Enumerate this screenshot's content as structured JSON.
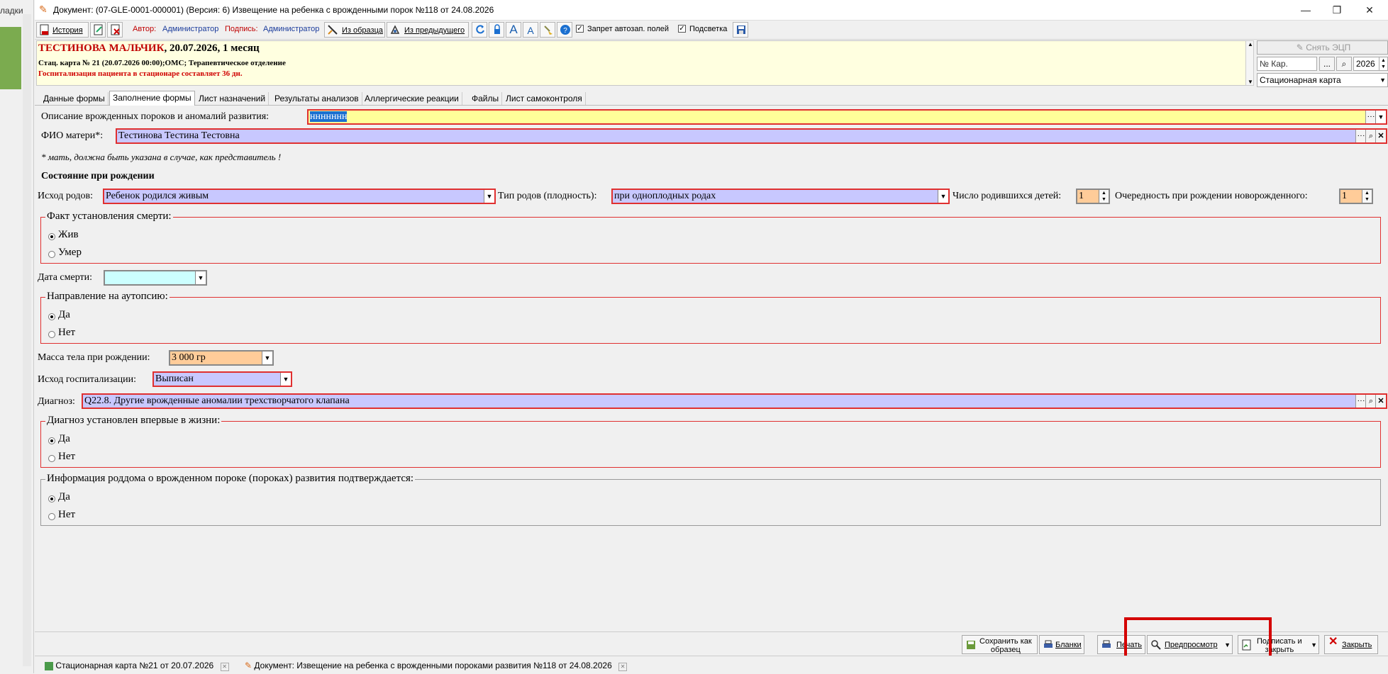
{
  "left_strip": {
    "label": "ладки"
  },
  "window": {
    "title": "Документ: (07-GLE-0001-000001) (Версия: 6) Извещение на ребенка с врожденными порок №118 от 24.08.2026",
    "minimize": "—",
    "restore": "❐",
    "close": "✕"
  },
  "toolbar": {
    "history": "История",
    "author_label": "Автор:",
    "author_value": "Администратор",
    "sign_label": "Подпись:",
    "sign_value": "Администратор",
    "from_sample": "Из образца",
    "from_previous": "Из предыдущего",
    "forbid_autofill": "Запрет автозап. полей",
    "highlight": "Подсветка"
  },
  "patient": {
    "name": "ТЕСТИНОВА МАЛЬЧИК",
    "name_rest": ", 20.07.2026, 1 месяц",
    "line2": "Стац. карта  № 21 (20.07.2026 00:00);ОМС; Терапевтическое отделение",
    "line3": "Госпитализация пациента в стационаре составляет 36 дн."
  },
  "right_panel": {
    "remove_ecp": "Снять ЭЦП",
    "card_no_placeholder": "№ Кар.",
    "ellipsis": "...",
    "year": "2026",
    "card_type": "Стационарная карта"
  },
  "tabs": [
    "Данные формы",
    "Заполнение формы",
    "Лист назначений",
    "Результаты анализов",
    "Аллергические реакции",
    "Файлы",
    "Лист самоконтроля"
  ],
  "form": {
    "anomalies_label": "Описание врожденных пороков и аномалий развития:",
    "anomalies_value": "ннннннн",
    "mother_label": "ФИО матери*:",
    "mother_value": "Тестинова Тестина Тестовна",
    "mother_note": "* мать, должна быть указана в случае, как представитель !",
    "birth_state": "Состояние при рождении",
    "birth_outcome_label": "Исход родов:",
    "birth_outcome_value": "Ребенок родился живым",
    "birth_type_label": "Тип родов (плодность):",
    "birth_type_value": "при одноплодных родах",
    "children_count_label": "Число родившихся детей:",
    "children_count_value": "1",
    "birth_order_label": "Очередность при рождении новорожденного:",
    "birth_order_value": "1",
    "death_fact_title": "Факт установления смерти:",
    "death_fact_opt1": "Жив",
    "death_fact_opt2": "Умер",
    "death_date_label": "Дата смерти:",
    "autopsy_title": "Направление на аутопсию:",
    "autopsy_opt1": "Да",
    "autopsy_opt2": "Нет",
    "weight_label": "Масса тела при рождении:",
    "weight_value": "3 000 гр",
    "hosp_outcome_label": "Исход госпитализации:",
    "hosp_outcome_value": "Выписан",
    "diagnosis_label": "Диагноз:",
    "diagnosis_value": "Q22.8. Другие врожденные аномалии трехстворчатого клапана",
    "first_time_title": "Диагноз установлен впервые в жизни:",
    "first_time_opt1": "Да",
    "first_time_opt2": "Нет",
    "confirm_title": "Информация роддома о врожденном пороке (пороках) развития подтверждается:",
    "confirm_opt1": "Да",
    "confirm_opt2": "Нет"
  },
  "bottom": {
    "save_as_sample_1": "Сохранить как",
    "save_as_sample_2": "образец",
    "blanks": "Бланки",
    "print": "Печать",
    "preview": "Предпросмотр",
    "sign_close_1": "Подписать и",
    "sign_close_2": "закрыть",
    "close": "Закрыть"
  },
  "doc_tabs": {
    "tab1": "Стационарная карта №21 от 20.07.2026",
    "tab2": "Документ: Извещение на ребенка с врожденными пороками развития №118 от 24.08.2026"
  },
  "colors": {
    "accent_red": "#d40000",
    "field_yellow": "#ffff99",
    "field_lavender": "#c8c8ff",
    "field_cyan": "#ccffff",
    "field_orange": "#ffcc99",
    "header_bg": "#ffffe0"
  }
}
